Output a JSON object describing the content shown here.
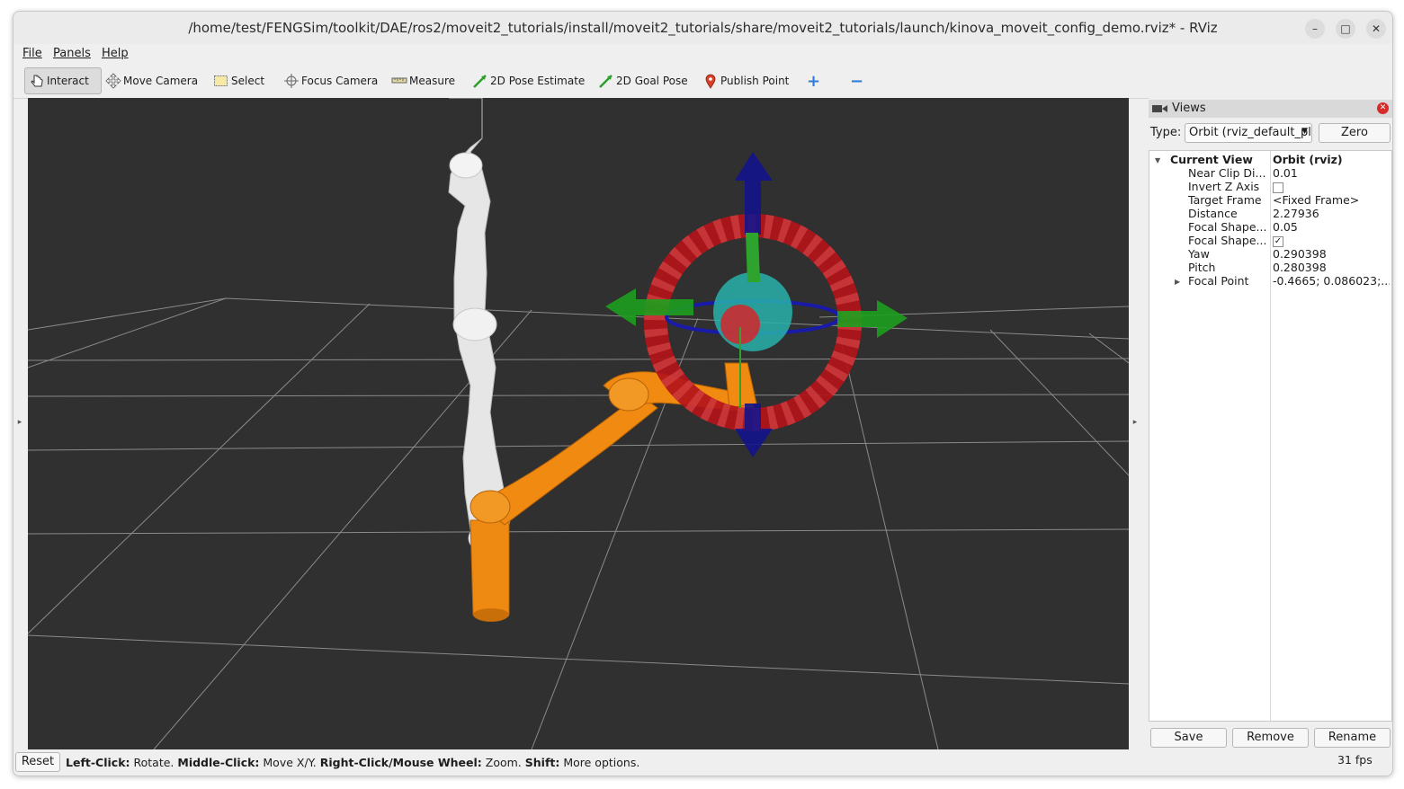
{
  "window": {
    "title": "/home/test/FENGSim/toolkit/DAE/ros2/moveit2_tutorials/install/moveit2_tutorials/share/moveit2_tutorials/launch/kinova_moveit_config_demo.rviz* - RViz",
    "minimize_glyph": "–",
    "maximize_glyph": "□",
    "close_glyph": "✕"
  },
  "menu": {
    "file": "File",
    "panels": "Panels",
    "help": "Help"
  },
  "toolbar": {
    "interact": "Interact",
    "move_camera": "Move Camera",
    "select": "Select",
    "focus_camera": "Focus Camera",
    "measure": "Measure",
    "pose_estimate": "2D Pose Estimate",
    "goal_pose": "2D Goal Pose",
    "publish_point": "Publish Point",
    "add_glyph": "+",
    "remove_glyph": "−"
  },
  "views_panel": {
    "title": "Views",
    "type_label": "Type:",
    "type_value": "Orbit (rviz_default_plugins)",
    "zero_button": "Zero",
    "current_view": {
      "label": "Current View",
      "value": "Orbit (rviz)"
    },
    "properties": [
      {
        "key": "Near Clip Di...",
        "value": "0.01"
      },
      {
        "key": "Invert Z Axis",
        "value": ""
      },
      {
        "key": "Target Frame",
        "value": "<Fixed Frame>"
      },
      {
        "key": "Distance",
        "value": "2.27936"
      },
      {
        "key": "Focal Shape...",
        "value": "0.05"
      },
      {
        "key": "Focal Shape...",
        "value": "✓"
      },
      {
        "key": "Yaw",
        "value": "0.290398"
      },
      {
        "key": "Pitch",
        "value": "0.280398"
      },
      {
        "key": "Focal Point",
        "value": "-0.4665; 0.086023;..."
      }
    ],
    "save_button": "Save",
    "remove_button": "Remove",
    "rename_button": "Rename"
  },
  "status": {
    "reset_button": "Reset",
    "hint_parts": [
      {
        "b": "Left-Click:",
        "t": " Rotate. "
      },
      {
        "b": "Middle-Click:",
        "t": " Move X/Y. "
      },
      {
        "b": "Right-Click/Mouse Wheel:",
        "t": " Zoom. "
      },
      {
        "b": "Shift:",
        "t": " More options."
      }
    ],
    "fps": "31 fps"
  },
  "colors": {
    "viewport_bg": "#303030",
    "robot_white": "#e8e8e8",
    "robot_orange": "#f08a10",
    "ring_red": "#b3141a",
    "arrow_green": "#1e9e1e",
    "arrow_blue": "#14148c"
  }
}
